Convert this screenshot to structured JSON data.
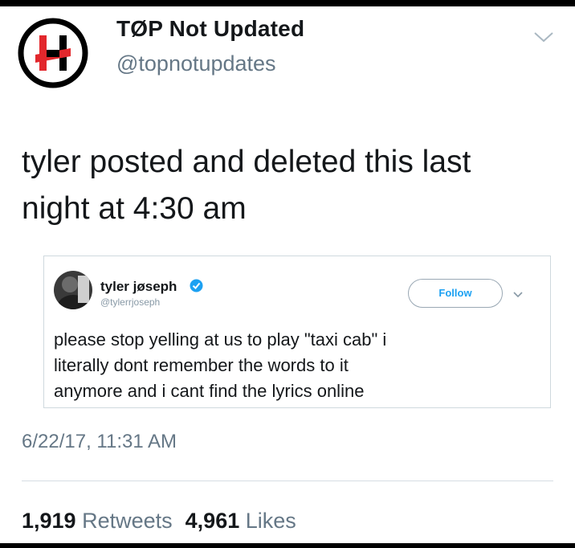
{
  "tweet": {
    "display_name": "TØP Not Updated",
    "handle": "@topnotupdates",
    "text": "tyler posted and deleted this last\nnight at 4:30 am",
    "timestamp": "6/22/17, 11:31 AM",
    "retweets_count": "1,919",
    "retweets_label": "Retweets",
    "likes_count": "4,961",
    "likes_label": "Likes"
  },
  "quoted_tweet": {
    "display_name": "tyler jøseph",
    "handle": "@tylerrjoseph",
    "follow_label": "Follow",
    "text": "please stop yelling at us to play \"taxi cab\" i\nliterally dont remember the words to it\nanymore and i cant find the lyrics online",
    "verified": true
  },
  "colors": {
    "brand_red": "#e2272c",
    "verified_blue": "#1da1f2",
    "secondary_text": "#657786"
  },
  "icons": {
    "avatar_logo": "band-logo-icon",
    "menu": "chevron-down-icon",
    "verified": "verified-badge-icon"
  }
}
